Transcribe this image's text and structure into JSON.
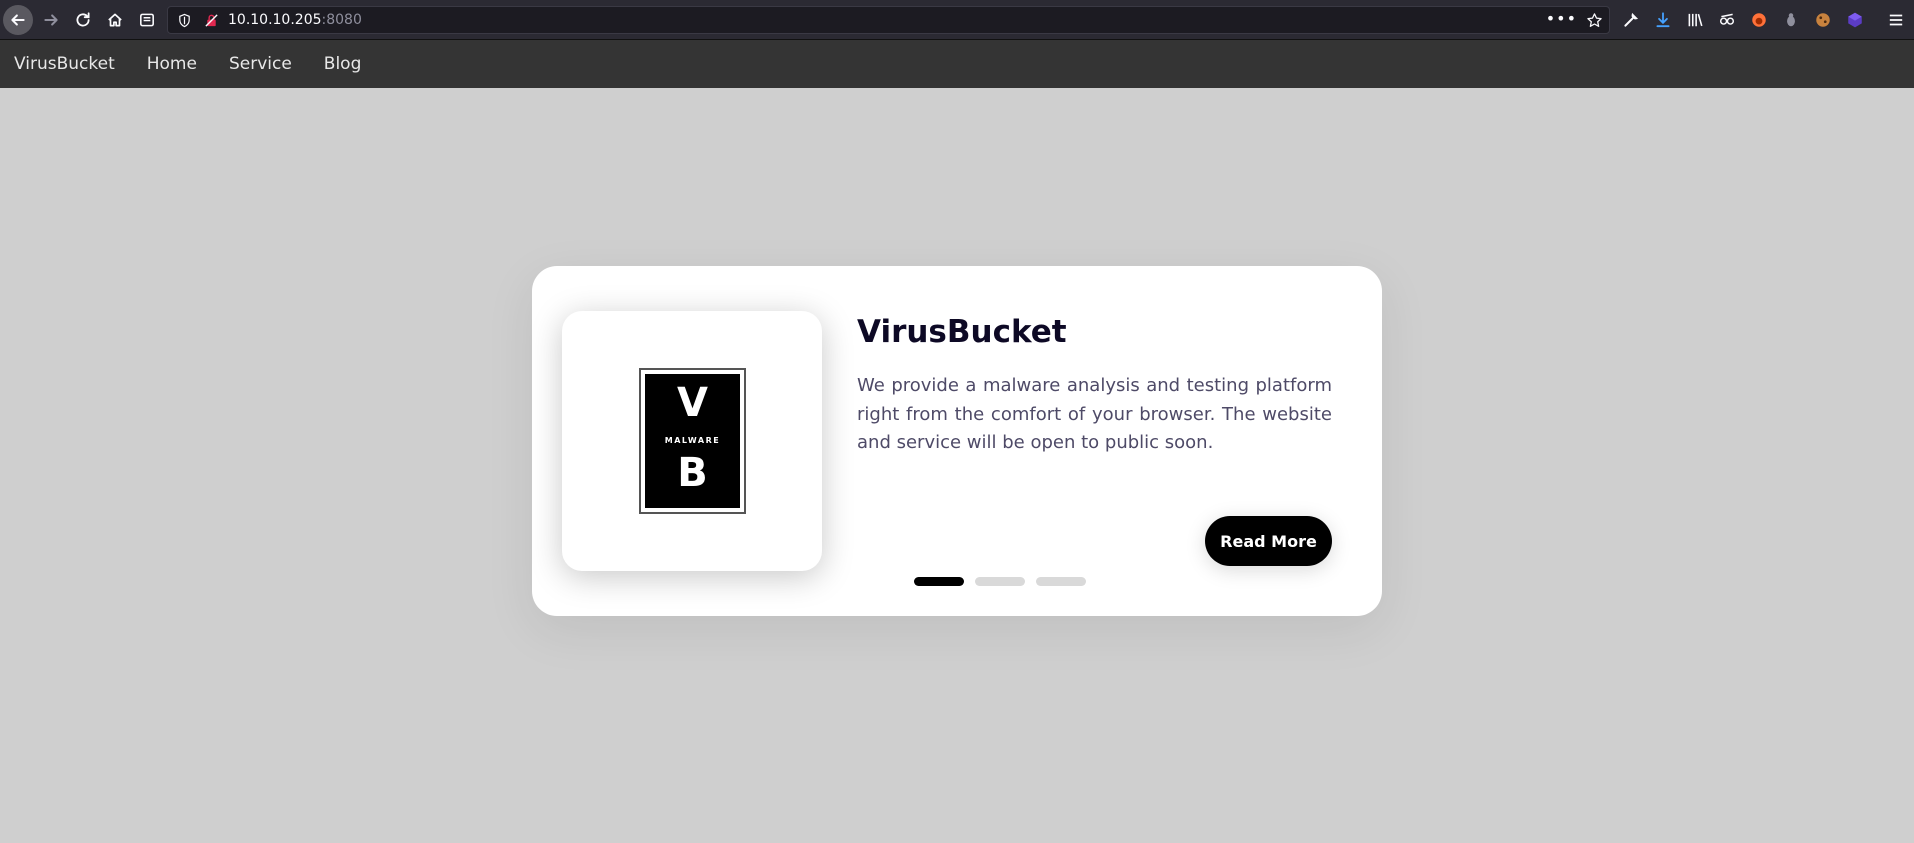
{
  "browser": {
    "url_host": "10.10.10.205",
    "url_port": ":8080"
  },
  "nav": {
    "brand": "VirusBucket",
    "links": [
      "Home",
      "Service",
      "Blog"
    ]
  },
  "card": {
    "logo": {
      "top": "V",
      "middle": "MALWARE",
      "bottom": "B"
    },
    "title": "VirusBucket",
    "text": "We provide a malware analysis and testing platform right from the comfort of your browser. The website and service will be open to public soon.",
    "button": "Read More",
    "slides": 3,
    "active_slide": 1
  },
  "colors": {
    "page_bg": "#cfcfcf",
    "nav_bg": "#343434",
    "title": "#0d0925",
    "text": "#4e4a67",
    "button_bg": "#000000"
  }
}
